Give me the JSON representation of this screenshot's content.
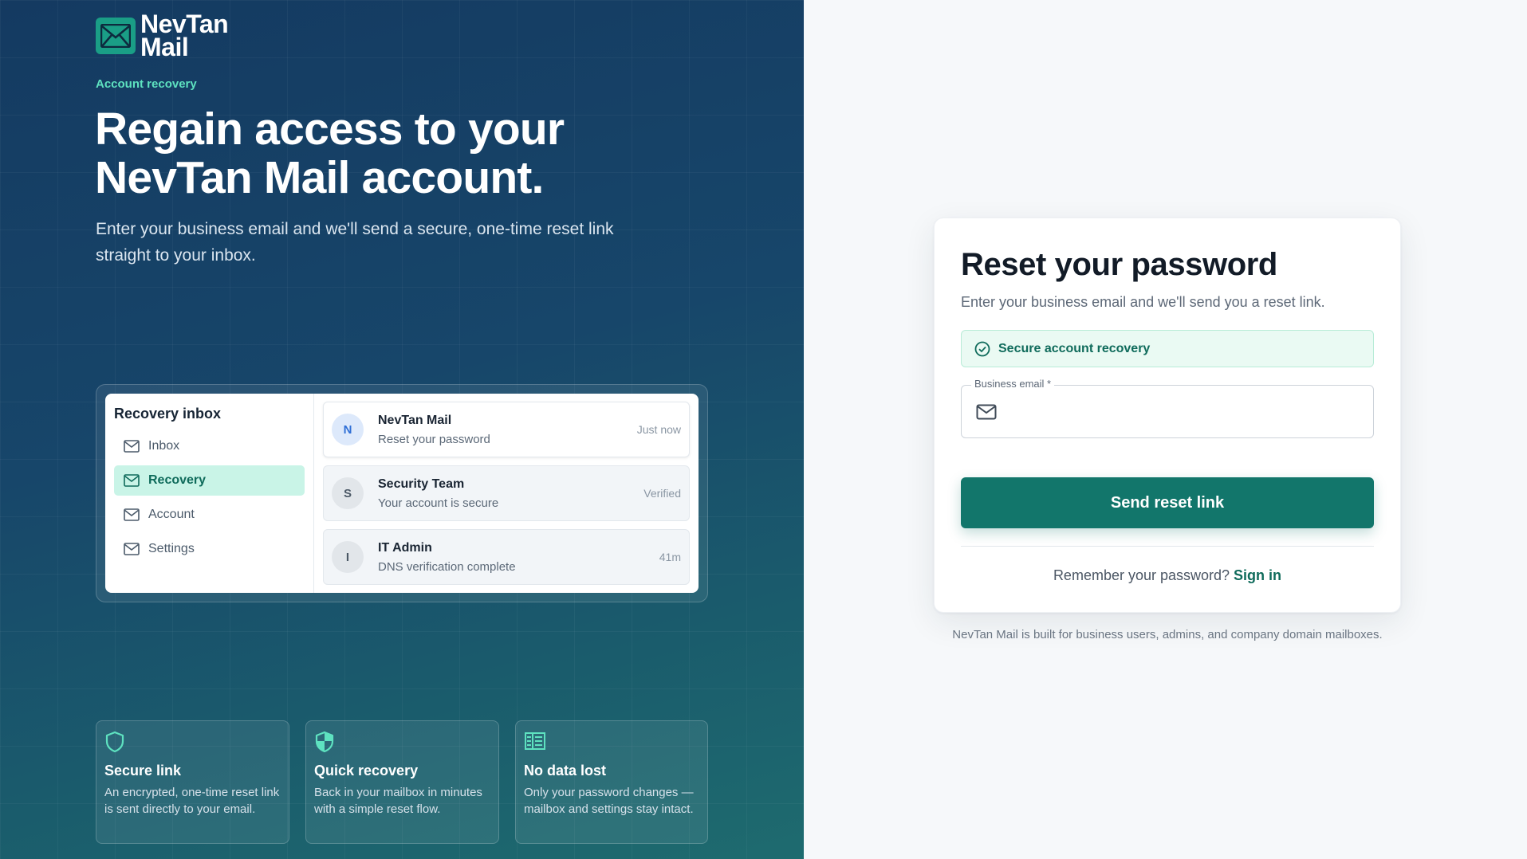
{
  "brand": {
    "line1": "NevTan",
    "line2": "Mail"
  },
  "hero": {
    "eyebrow": "Account recovery",
    "title_line1": "Regain access to your",
    "title_line2": "NevTan Mail account.",
    "subtitle": "Enter your business email and we'll send a secure, one-time reset link straight to your inbox."
  },
  "preview": {
    "title": "Recovery inbox",
    "nav": [
      {
        "label": "Inbox",
        "icon": "mail-icon",
        "active": false
      },
      {
        "label": "Recovery",
        "icon": "mail-icon",
        "active": true
      },
      {
        "label": "Account",
        "icon": "mail-icon",
        "active": false
      },
      {
        "label": "Settings",
        "icon": "mail-icon",
        "active": false
      }
    ],
    "messages": [
      {
        "initial": "N",
        "from": "NevTan Mail",
        "subject": "Reset your password",
        "meta": "Just now"
      },
      {
        "initial": "S",
        "from": "Security Team",
        "subject": "Your account is secure",
        "meta": "Verified"
      },
      {
        "initial": "I",
        "from": "IT Admin",
        "subject": "DNS verification complete",
        "meta": "41m"
      }
    ]
  },
  "features": [
    {
      "icon": "shield-icon",
      "title": "Secure link",
      "desc": "An encrypted, one-time reset link is sent directly to your email."
    },
    {
      "icon": "shield-half-icon",
      "title": "Quick recovery",
      "desc": "Back in your mailbox in minutes with a simple reset flow."
    },
    {
      "icon": "building-icon",
      "title": "No data lost",
      "desc": "Only your password changes — mailbox and settings stay intact."
    }
  ],
  "form": {
    "title": "Reset your password",
    "subtitle": "Enter your business email and we'll send you a reset link.",
    "notice": "Secure account recovery",
    "email_label": "Business email *",
    "email_value": "",
    "submit": "Send reset link",
    "remember_text": "Remember your password?",
    "signin": "Sign in"
  },
  "footnote": "NevTan Mail is built for business users, admins, and company domain mailboxes.",
  "colors": {
    "accent": "#12766b",
    "mint": "#5ee2c0",
    "panel": "#143a61"
  }
}
